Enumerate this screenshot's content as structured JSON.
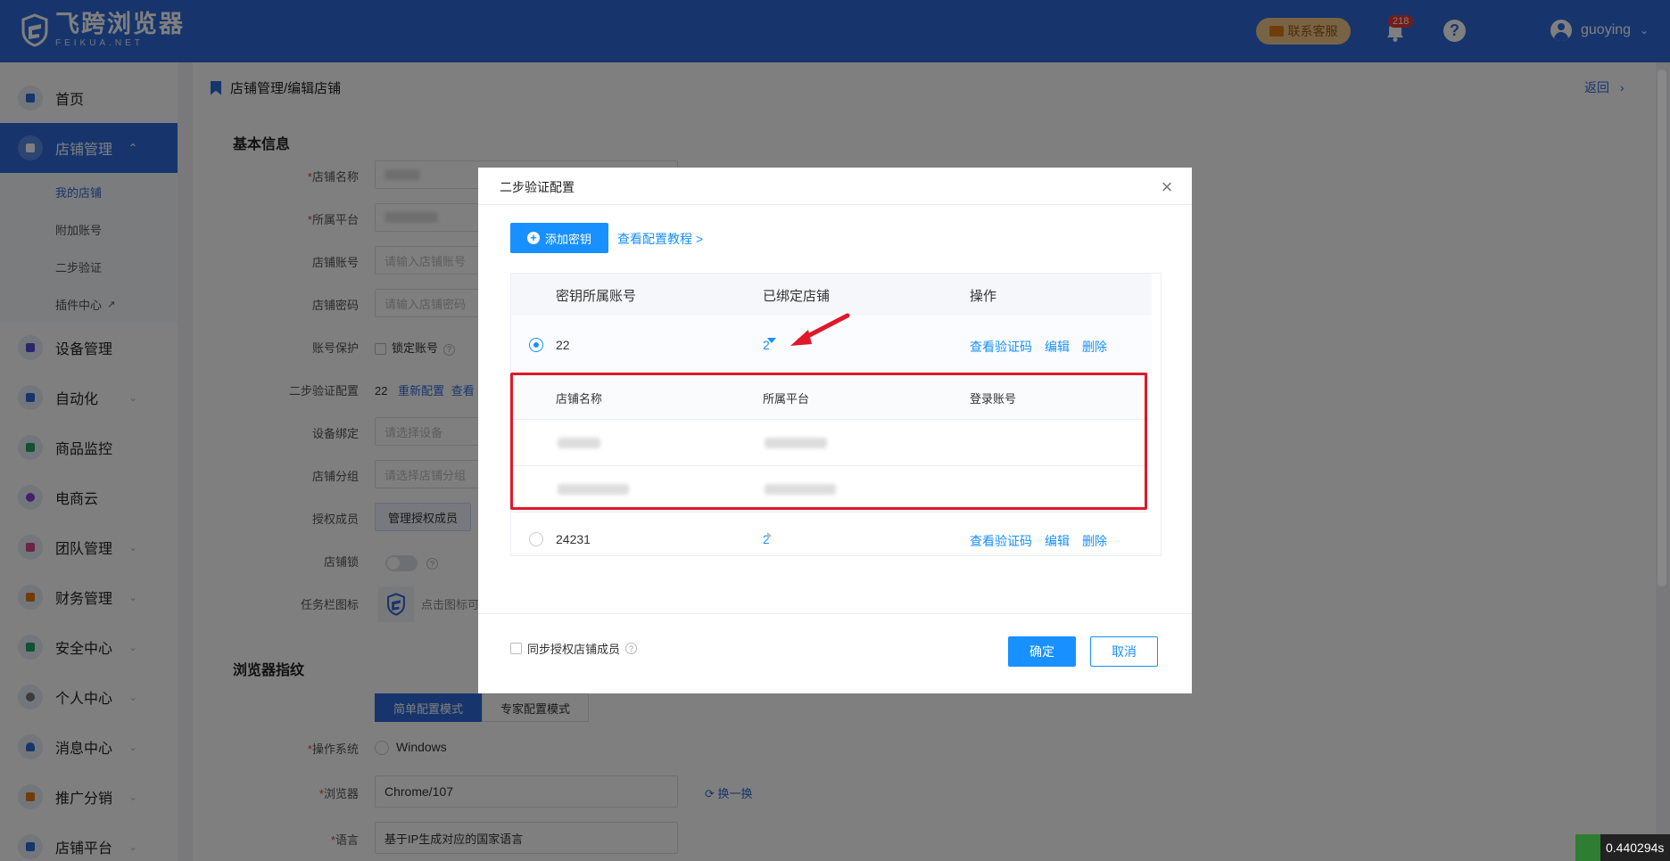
{
  "app": {
    "logo_title": "飞跨浏览器",
    "logo_sub": "FEIKUA.NET",
    "support_label": "联系客服",
    "notification_count": "218",
    "help_glyph": "?",
    "username": "guoying"
  },
  "sidebar": {
    "items": [
      {
        "label": "首页",
        "icon": "home-icon",
        "color": "#2f6bd8"
      },
      {
        "label": "店铺管理",
        "icon": "shop-icon",
        "color": "#ffffff"
      },
      {
        "label": "设备管理",
        "icon": "device-icon",
        "color": "#5b4bd8"
      },
      {
        "label": "自动化",
        "icon": "robot-icon",
        "color": "#2f6bd8"
      },
      {
        "label": "商品监控",
        "icon": "monitor-icon",
        "color": "#22a36b"
      },
      {
        "label": "电商云",
        "icon": "cloud-icon",
        "color": "#8b3fd8"
      },
      {
        "label": "团队管理",
        "icon": "team-icon",
        "color": "#d84b8b"
      },
      {
        "label": "财务管理",
        "icon": "wallet-icon",
        "color": "#e07a15"
      },
      {
        "label": "安全中心",
        "icon": "shield-icon",
        "color": "#22a36b"
      },
      {
        "label": "个人中心",
        "icon": "user-icon",
        "color": "#777777"
      },
      {
        "label": "消息中心",
        "icon": "bell-icon",
        "color": "#2f6bd8"
      },
      {
        "label": "推广分销",
        "icon": "megaphone-icon",
        "color": "#e07a15"
      },
      {
        "label": "店铺平台",
        "icon": "platform-icon",
        "color": "#2f6bd8"
      }
    ],
    "sub_items": [
      "我的店铺",
      "附加账号",
      "二步验证",
      "插件中心"
    ]
  },
  "main": {
    "breadcrumb": "店铺管理/编辑店铺",
    "back_label": "返回",
    "section_basic": "基本信息",
    "section_fingerprint": "浏览器指纹",
    "labels": {
      "shop_name": "店铺名称",
      "platform": "所属平台",
      "account": "店铺账号",
      "password": "店铺密码",
      "protection": "账号保护",
      "two_step": "二步验证配置",
      "device": "设备绑定",
      "group": "店铺分组",
      "members": "授权成员",
      "lock": "店铺锁",
      "taskbar": "任务栏图标",
      "os": "操作系统",
      "browser": "浏览器",
      "language": "语言"
    },
    "placeholders": {
      "account": "请输入店铺账号",
      "password": "请输入店铺密码",
      "device": "请选择设备",
      "group": "请选择店铺分组"
    },
    "lock_account_label": "锁定账号",
    "two_step_value": "22",
    "reconfigure_label": "重新配置",
    "view_label_truncated": "查看",
    "manage_members_label": "管理授权成员",
    "taskbar_hint": "点击图标可",
    "mode_simple": "简单配置模式",
    "mode_expert": "专家配置模式",
    "os_value": "Windows",
    "browser_value": "Chrome/107",
    "swap_label": "换一换",
    "language_value": "基于IP生成对应的国家语言"
  },
  "modal": {
    "title": "二步验证配置",
    "add_key_label": "添加密钥",
    "tutorial_label": "查看配置教程 >",
    "columns": {
      "account": "密钥所属账号",
      "bound": "已绑定店铺",
      "ops": "操作"
    },
    "rows": [
      {
        "account": "22",
        "bound": "2",
        "selected": true,
        "expanded": true
      },
      {
        "account": "24231",
        "bound": "2",
        "selected": false,
        "expanded": false
      }
    ],
    "op_labels": {
      "view_code": "查看验证码",
      "edit": "编辑",
      "delete": "删除"
    },
    "sub_columns": {
      "name": "店铺名称",
      "platform": "所属平台",
      "login": "登录账号"
    },
    "sync_label": "同步授权店铺成员",
    "ok_label": "确定",
    "cancel_label": "取消"
  },
  "timer_label": "0.440294s"
}
